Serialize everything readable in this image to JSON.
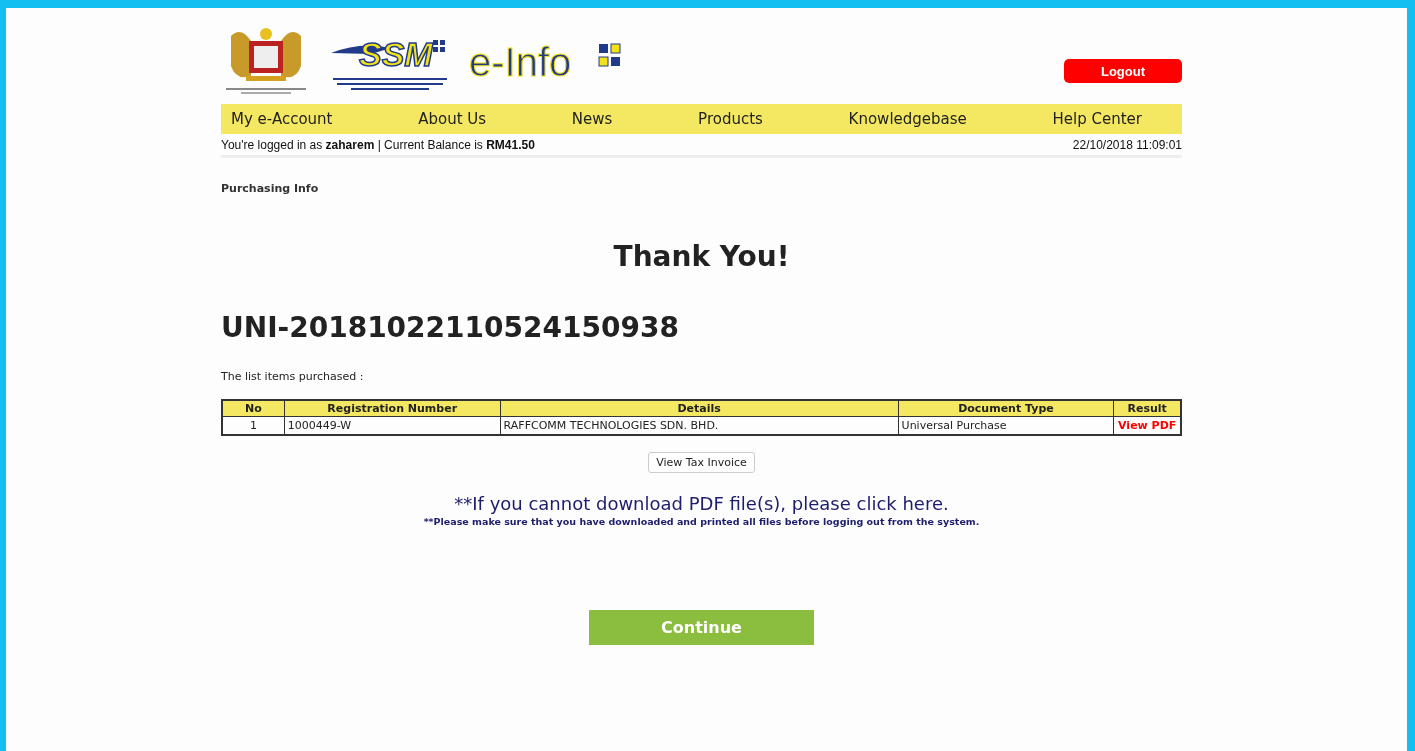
{
  "header": {
    "logos": [
      {
        "kind": "crest"
      },
      {
        "kind": "ssm",
        "text": "SSM"
      },
      {
        "kind": "einfo",
        "text": "e-Info"
      }
    ],
    "logout": "Logout"
  },
  "nav": [
    "My e-Account",
    "About Us",
    "News",
    "Products",
    "Knowledgebase",
    "Help Center"
  ],
  "status": {
    "login": "You're logged in as **zaharem** | Current Balance is **RM41.50**",
    "datetime": "22/10/2018 11:09:01"
  },
  "breadcrumb": "Purchasing Info",
  "heading": "Thank You!",
  "order_id": "UNI-20181022110524150938",
  "list_label": "The list items purchased :",
  "table": {
    "columns": [
      "No",
      "Registration Number",
      "Details",
      "Document Type",
      "Result"
    ],
    "rows": [
      {
        "no": "1",
        "registration_number": "1000449-W",
        "details": "RAFFCOMM TECHNOLOGIES SDN. BHD.",
        "document_type": "Universal Purchase",
        "result": "View PDF"
      }
    ]
  },
  "tax_invoice_button": "View Tax Invoice",
  "download_link": "**If you cannot download PDF file(s), please click here.",
  "note": "**Please make sure that you have downloaded and printed all files before logging out from the system.",
  "continue_button": "Continue"
}
